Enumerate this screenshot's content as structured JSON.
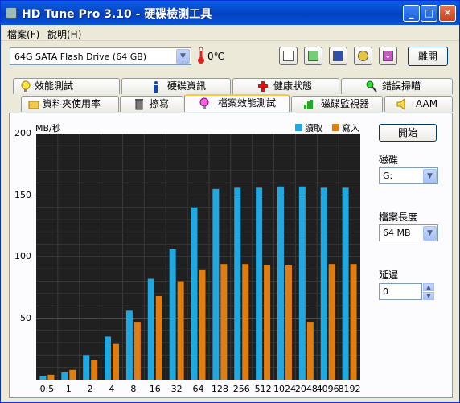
{
  "window": {
    "title": "HD Tune Pro 3.10 - 硬碟檢測工具",
    "minimize": "_",
    "maximize": "□",
    "close": "✕"
  },
  "menu": [
    {
      "label": "檔案(F)"
    },
    {
      "label": "說明(H)"
    }
  ],
  "toolbar": {
    "drive": "64G SATA Flash Drive (64 GB)",
    "temperature": "0℃",
    "icons": [
      "copy-info-icon",
      "copy-screenshot-icon",
      "save-icon",
      "settings-icon",
      "download-icon"
    ],
    "exit_label": "離開"
  },
  "tabs_row1": [
    {
      "label": "效能測試",
      "icon": "bulb-icon"
    },
    {
      "label": "硬碟資訊",
      "icon": "info-icon"
    },
    {
      "label": "健康狀態",
      "icon": "health-cross-icon"
    },
    {
      "label": "錯誤掃瞄",
      "icon": "magnifier-icon"
    }
  ],
  "tabs_row2": [
    {
      "label": "資料夾使用率",
      "icon": "folder-icon"
    },
    {
      "label": "擦寫",
      "icon": "trash-icon"
    },
    {
      "label": "檔案效能測試",
      "icon": "file-benchmark-icon",
      "active": true
    },
    {
      "label": "磁碟監視器",
      "icon": "monitor-chart-icon"
    },
    {
      "label": "AAM",
      "icon": "speaker-icon"
    }
  ],
  "side": {
    "start_label": "開始",
    "drive_label": "磁碟",
    "drive_value": "G:",
    "file_length_label": "檔案長度",
    "file_length_value": "64 MB",
    "delay_label": "延遲",
    "delay_value": "0"
  },
  "colors": {
    "read": "#1fa9e0",
    "write": "#e07d10",
    "plot_bg": "#202020",
    "grid": "#3a3a3a"
  },
  "chart_data": {
    "type": "bar",
    "ylabel": "MB/秒",
    "ylim": [
      0,
      200
    ],
    "yticks": [
      50,
      100,
      150,
      200
    ],
    "categories": [
      "0.5",
      "1",
      "2",
      "4",
      "8",
      "16",
      "32",
      "64",
      "128",
      "256",
      "512",
      "1024",
      "2048",
      "4096",
      "8192"
    ],
    "series": [
      {
        "name": "讀取",
        "values": [
          3,
          6,
          20,
          35,
          56,
          82,
          106,
          140,
          155,
          156,
          156,
          157,
          157,
          156,
          156
        ]
      },
      {
        "name": "寫入",
        "values": [
          4,
          8,
          16,
          29,
          47,
          68,
          80,
          89,
          94,
          94,
          93,
          93,
          47,
          94,
          94
        ]
      }
    ],
    "grid": true,
    "legend": "top-right"
  }
}
